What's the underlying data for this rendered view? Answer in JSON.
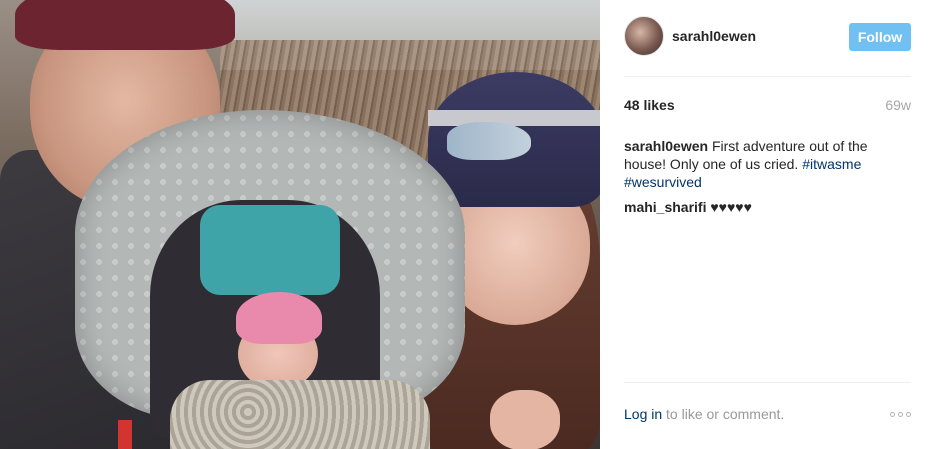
{
  "post": {
    "photo_alt": "",
    "author": {
      "username": "sarahl0ewen",
      "avatar_icon": "avatar-icon"
    },
    "follow_label": "Follow",
    "likes": "48 likes",
    "age": "69w",
    "caption": {
      "username": "sarahl0ewen",
      "text": " First adventure out of the house! Only one of us cried. ",
      "hashtags": [
        "#itwasme",
        "#wesurvived"
      ]
    },
    "comments": [
      {
        "username": "mahi_sharifi",
        "text": " ♥♥♥♥♥"
      }
    ],
    "login": {
      "link": "Log in",
      "text": " to like or comment."
    },
    "more_icon": "more-options-icon"
  },
  "colors": {
    "follow_bg": "#70c0f2",
    "hashtag": "#003569",
    "muted": "#a6a6a6"
  }
}
